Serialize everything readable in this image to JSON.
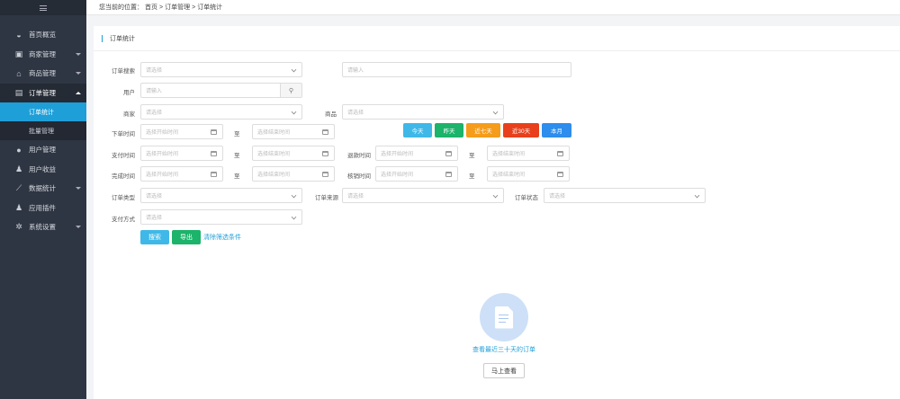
{
  "breadcrumb": {
    "prefix": "您当前的位置：",
    "home": "首页",
    "sep1": ">",
    "section": "订单管理",
    "sep2": ">",
    "page": "订单统计"
  },
  "sidebar": {
    "items": [
      {
        "label": "首页概览",
        "icon": "dashboard-icon"
      },
      {
        "label": "商家管理",
        "icon": "id-card-icon"
      },
      {
        "label": "商品管理",
        "icon": "shop-icon"
      },
      {
        "label": "订单管理",
        "icon": "order-icon"
      },
      {
        "label": "用户管理",
        "icon": "user-icon"
      },
      {
        "label": "用户收益",
        "icon": "user-money-icon"
      },
      {
        "label": "数据统计",
        "icon": "chart-icon"
      },
      {
        "label": "应用插件",
        "icon": "plugin-icon"
      },
      {
        "label": "系统设置",
        "icon": "gear-icon"
      }
    ],
    "sub": [
      "订单统计",
      "批量管理"
    ]
  },
  "panel": {
    "title": "订单统计"
  },
  "form": {
    "order_search_label": "订单搜索",
    "select_ph": "请选择",
    "input_ph": "请输入",
    "user_label": "用户",
    "merchant_label": "商家",
    "goods_label": "商品",
    "order_time_label": "下单时间",
    "pay_time_label": "支付时间",
    "refund_time_label": "退款时间",
    "finish_time_label": "完成时间",
    "verify_time_label": "核销时间",
    "start_ph": "选择开始时间",
    "end_ph": "选择结束时间",
    "to": "至",
    "order_type_label": "订单类型",
    "order_source_label": "订单来源",
    "order_status_label": "订单状态",
    "pay_method_label": "支付方式"
  },
  "quick": {
    "today": "今天",
    "yesterday": "昨天",
    "week": "近七天",
    "month30": "近30天",
    "this_month": "本月"
  },
  "actions": {
    "search": "搜索",
    "export": "导出",
    "clear": "清除筛选条件"
  },
  "empty": {
    "text": "查看最近三十天的订单",
    "button": "马上查看"
  },
  "colors": {
    "sidebar": "#2f3643",
    "active": "#1e9fd8",
    "today": "#3fb8e8",
    "yesterday": "#1cb36a",
    "week": "#f59c1a",
    "month30": "#e8401c",
    "this_month": "#2e8ded"
  }
}
